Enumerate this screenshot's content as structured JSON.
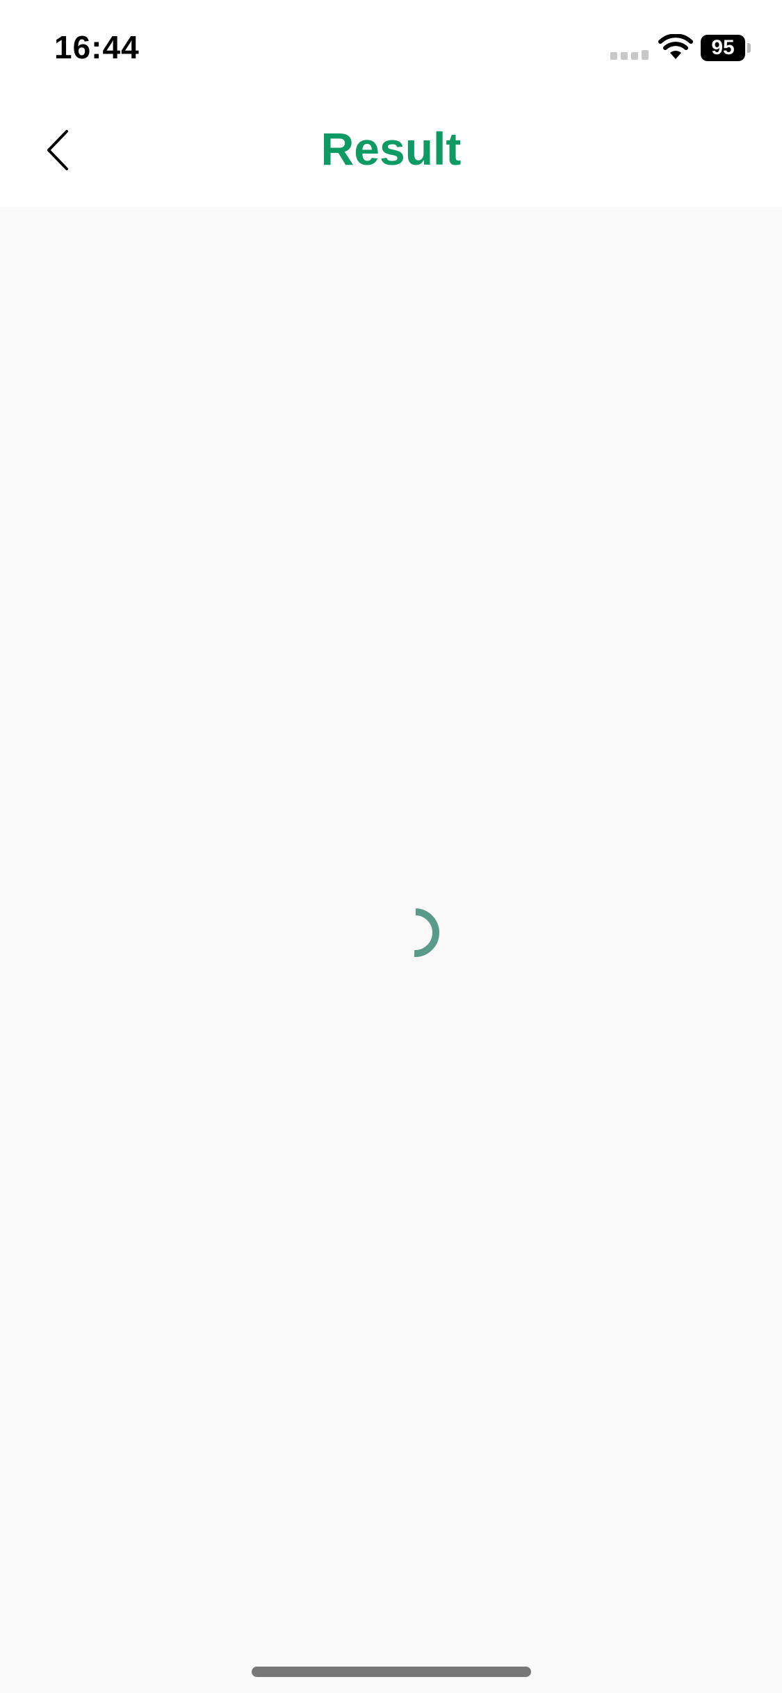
{
  "status_bar": {
    "time": "16:44",
    "battery_level": "95",
    "signal_icon": "cellular-signal-icon",
    "wifi_icon": "wifi-icon",
    "battery_icon": "battery-icon"
  },
  "header": {
    "title": "Result",
    "back_icon": "chevron-left-icon"
  },
  "content": {
    "loading_icon": "loading-spinner-icon"
  },
  "colors": {
    "title": "#0E9A63",
    "spinner": "#5A9A88",
    "background": "#F9F9F9",
    "header_background": "#FFFFFF"
  }
}
